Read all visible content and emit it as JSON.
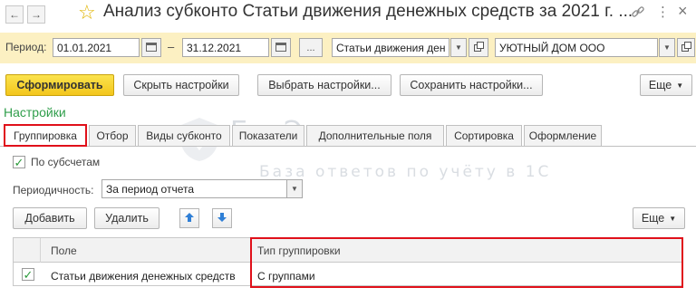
{
  "window": {
    "title": "Анализ субконто Статьи движения денежных средств за 2021 г. ...",
    "back_glyph": "←",
    "forward_glyph": "→",
    "star_glyph": "☆",
    "link_glyph": "🔗",
    "more_glyph": "⋮",
    "close_glyph": "×"
  },
  "period": {
    "label": "Период:",
    "from": "01.01.2021",
    "dash": "–",
    "to": "31.12.2021",
    "dots_label": "...",
    "account": "Статьи движения ден",
    "organization": "УЮТНЫЙ ДОМ ООО"
  },
  "toolbar": {
    "generate": "Сформировать",
    "hide_settings": "Скрыть настройки",
    "choose_settings": "Выбрать настройки...",
    "save_settings": "Сохранить настройки...",
    "more": "Еще"
  },
  "settings_title": "Настройки",
  "tabs": [
    {
      "label": "Группировка"
    },
    {
      "label": "Отбор"
    },
    {
      "label": "Виды субконто"
    },
    {
      "label": "Показатели"
    },
    {
      "label": "Дополнительные поля"
    },
    {
      "label": "Сортировка"
    },
    {
      "label": "Оформление"
    }
  ],
  "grouping": {
    "by_subaccounts_label": "По субсчетам",
    "by_subaccounts_checked": true,
    "periodicity_label": "Периодичность:",
    "periodicity_value": "За период отчета",
    "add": "Добавить",
    "delete": "Удалить",
    "more": "Еще",
    "columns": [
      "Поле",
      "Тип группировки"
    ],
    "rows": [
      {
        "checked": true,
        "field": "Статьи движения денежных средств",
        "type": "С группами"
      }
    ]
  },
  "watermark": {
    "brand": "БухЭксперт",
    "tagline": "База ответов по учёту в 1С"
  },
  "colors": {
    "accent_green": "#2f9e4b",
    "primary_button": "#f3c61c",
    "period_bar": "#fcf0c2",
    "highlight_red": "#e0101a"
  }
}
